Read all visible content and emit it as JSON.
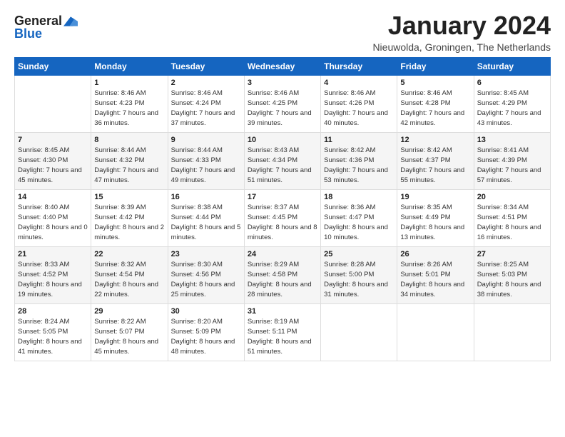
{
  "logo": {
    "line1": "General",
    "line2": "Blue",
    "icon_color": "#1565c0"
  },
  "title": "January 2024",
  "location": "Nieuwolda, Groningen, The Netherlands",
  "days_of_week": [
    "Sunday",
    "Monday",
    "Tuesday",
    "Wednesday",
    "Thursday",
    "Friday",
    "Saturday"
  ],
  "weeks": [
    [
      {
        "day": "",
        "sunrise": "",
        "sunset": "",
        "daylight": ""
      },
      {
        "day": "1",
        "sunrise": "Sunrise: 8:46 AM",
        "sunset": "Sunset: 4:23 PM",
        "daylight": "Daylight: 7 hours and 36 minutes."
      },
      {
        "day": "2",
        "sunrise": "Sunrise: 8:46 AM",
        "sunset": "Sunset: 4:24 PM",
        "daylight": "Daylight: 7 hours and 37 minutes."
      },
      {
        "day": "3",
        "sunrise": "Sunrise: 8:46 AM",
        "sunset": "Sunset: 4:25 PM",
        "daylight": "Daylight: 7 hours and 39 minutes."
      },
      {
        "day": "4",
        "sunrise": "Sunrise: 8:46 AM",
        "sunset": "Sunset: 4:26 PM",
        "daylight": "Daylight: 7 hours and 40 minutes."
      },
      {
        "day": "5",
        "sunrise": "Sunrise: 8:46 AM",
        "sunset": "Sunset: 4:28 PM",
        "daylight": "Daylight: 7 hours and 42 minutes."
      },
      {
        "day": "6",
        "sunrise": "Sunrise: 8:45 AM",
        "sunset": "Sunset: 4:29 PM",
        "daylight": "Daylight: 7 hours and 43 minutes."
      }
    ],
    [
      {
        "day": "7",
        "sunrise": "Sunrise: 8:45 AM",
        "sunset": "Sunset: 4:30 PM",
        "daylight": "Daylight: 7 hours and 45 minutes."
      },
      {
        "day": "8",
        "sunrise": "Sunrise: 8:44 AM",
        "sunset": "Sunset: 4:32 PM",
        "daylight": "Daylight: 7 hours and 47 minutes."
      },
      {
        "day": "9",
        "sunrise": "Sunrise: 8:44 AM",
        "sunset": "Sunset: 4:33 PM",
        "daylight": "Daylight: 7 hours and 49 minutes."
      },
      {
        "day": "10",
        "sunrise": "Sunrise: 8:43 AM",
        "sunset": "Sunset: 4:34 PM",
        "daylight": "Daylight: 7 hours and 51 minutes."
      },
      {
        "day": "11",
        "sunrise": "Sunrise: 8:42 AM",
        "sunset": "Sunset: 4:36 PM",
        "daylight": "Daylight: 7 hours and 53 minutes."
      },
      {
        "day": "12",
        "sunrise": "Sunrise: 8:42 AM",
        "sunset": "Sunset: 4:37 PM",
        "daylight": "Daylight: 7 hours and 55 minutes."
      },
      {
        "day": "13",
        "sunrise": "Sunrise: 8:41 AM",
        "sunset": "Sunset: 4:39 PM",
        "daylight": "Daylight: 7 hours and 57 minutes."
      }
    ],
    [
      {
        "day": "14",
        "sunrise": "Sunrise: 8:40 AM",
        "sunset": "Sunset: 4:40 PM",
        "daylight": "Daylight: 8 hours and 0 minutes."
      },
      {
        "day": "15",
        "sunrise": "Sunrise: 8:39 AM",
        "sunset": "Sunset: 4:42 PM",
        "daylight": "Daylight: 8 hours and 2 minutes."
      },
      {
        "day": "16",
        "sunrise": "Sunrise: 8:38 AM",
        "sunset": "Sunset: 4:44 PM",
        "daylight": "Daylight: 8 hours and 5 minutes."
      },
      {
        "day": "17",
        "sunrise": "Sunrise: 8:37 AM",
        "sunset": "Sunset: 4:45 PM",
        "daylight": "Daylight: 8 hours and 8 minutes."
      },
      {
        "day": "18",
        "sunrise": "Sunrise: 8:36 AM",
        "sunset": "Sunset: 4:47 PM",
        "daylight": "Daylight: 8 hours and 10 minutes."
      },
      {
        "day": "19",
        "sunrise": "Sunrise: 8:35 AM",
        "sunset": "Sunset: 4:49 PM",
        "daylight": "Daylight: 8 hours and 13 minutes."
      },
      {
        "day": "20",
        "sunrise": "Sunrise: 8:34 AM",
        "sunset": "Sunset: 4:51 PM",
        "daylight": "Daylight: 8 hours and 16 minutes."
      }
    ],
    [
      {
        "day": "21",
        "sunrise": "Sunrise: 8:33 AM",
        "sunset": "Sunset: 4:52 PM",
        "daylight": "Daylight: 8 hours and 19 minutes."
      },
      {
        "day": "22",
        "sunrise": "Sunrise: 8:32 AM",
        "sunset": "Sunset: 4:54 PM",
        "daylight": "Daylight: 8 hours and 22 minutes."
      },
      {
        "day": "23",
        "sunrise": "Sunrise: 8:30 AM",
        "sunset": "Sunset: 4:56 PM",
        "daylight": "Daylight: 8 hours and 25 minutes."
      },
      {
        "day": "24",
        "sunrise": "Sunrise: 8:29 AM",
        "sunset": "Sunset: 4:58 PM",
        "daylight": "Daylight: 8 hours and 28 minutes."
      },
      {
        "day": "25",
        "sunrise": "Sunrise: 8:28 AM",
        "sunset": "Sunset: 5:00 PM",
        "daylight": "Daylight: 8 hours and 31 minutes."
      },
      {
        "day": "26",
        "sunrise": "Sunrise: 8:26 AM",
        "sunset": "Sunset: 5:01 PM",
        "daylight": "Daylight: 8 hours and 34 minutes."
      },
      {
        "day": "27",
        "sunrise": "Sunrise: 8:25 AM",
        "sunset": "Sunset: 5:03 PM",
        "daylight": "Daylight: 8 hours and 38 minutes."
      }
    ],
    [
      {
        "day": "28",
        "sunrise": "Sunrise: 8:24 AM",
        "sunset": "Sunset: 5:05 PM",
        "daylight": "Daylight: 8 hours and 41 minutes."
      },
      {
        "day": "29",
        "sunrise": "Sunrise: 8:22 AM",
        "sunset": "Sunset: 5:07 PM",
        "daylight": "Daylight: 8 hours and 45 minutes."
      },
      {
        "day": "30",
        "sunrise": "Sunrise: 8:20 AM",
        "sunset": "Sunset: 5:09 PM",
        "daylight": "Daylight: 8 hours and 48 minutes."
      },
      {
        "day": "31",
        "sunrise": "Sunrise: 8:19 AM",
        "sunset": "Sunset: 5:11 PM",
        "daylight": "Daylight: 8 hours and 51 minutes."
      },
      {
        "day": "",
        "sunrise": "",
        "sunset": "",
        "daylight": ""
      },
      {
        "day": "",
        "sunrise": "",
        "sunset": "",
        "daylight": ""
      },
      {
        "day": "",
        "sunrise": "",
        "sunset": "",
        "daylight": ""
      }
    ]
  ]
}
